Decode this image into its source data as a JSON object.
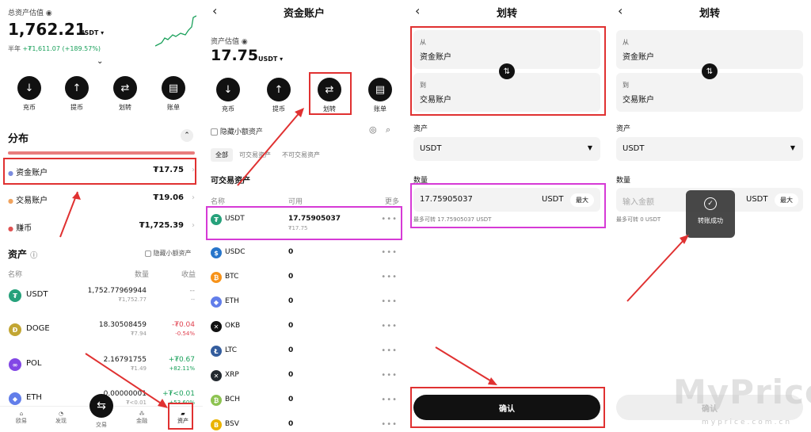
{
  "p1": {
    "total_label": "总资产估值",
    "total_value": "1,762.21",
    "total_unit": "USDT ▾",
    "period": "半年",
    "change": "+₮1,611.07 (+189.57%)",
    "actions": [
      "充币",
      "提币",
      "划转",
      "账单"
    ],
    "dist_title": "分布",
    "accounts": [
      {
        "name": "资金账户",
        "value": "₮17.75",
        "color": "#7b8cde"
      },
      {
        "name": "交易账户",
        "value": "₮19.06",
        "color": "#f0a35e"
      },
      {
        "name": "赚币",
        "value": "₮1,725.39",
        "color": "#e05252"
      }
    ],
    "assets_title": "资产",
    "hide_small": "隐藏小额资产",
    "cols": [
      "名称",
      "数量",
      "收益"
    ],
    "assets": [
      {
        "sym": "USDT",
        "qty": "1,752.77969944",
        "sub": "₮1,752.77",
        "pnl": "--",
        "pnl_pct": "--",
        "color": "#26a17b",
        "glyph": "₮",
        "tone": "neutral"
      },
      {
        "sym": "DOGE",
        "qty": "18.30508459",
        "sub": "₮7.94",
        "pnl": "-₮0.04",
        "pnl_pct": "-0.54%",
        "color": "#c2a633",
        "glyph": "Ð",
        "tone": "neg"
      },
      {
        "sym": "POL",
        "qty": "2.16791755",
        "sub": "₮1.49",
        "pnl": "+₮0.67",
        "pnl_pct": "+82.11%",
        "color": "#8247e5",
        "glyph": "∞",
        "tone": "pos"
      },
      {
        "sym": "ETH",
        "qty": "0.00000001",
        "sub": "₮<0.01",
        "pnl": "+₮<0.01",
        "pnl_pct": "+53.60%",
        "color": "#627eea",
        "glyph": "◆",
        "tone": "pos"
      }
    ],
    "tabbar": [
      "欧易",
      "发现",
      "交易",
      "金融",
      "资产"
    ]
  },
  "p2": {
    "title": "资金账户",
    "est_label": "资产估值",
    "est_value": "17.75",
    "est_unit": "USDT ▾",
    "actions": [
      "充币",
      "提币",
      "划转",
      "账单"
    ],
    "hide_small": "隐藏小额资产",
    "filters": [
      "全部",
      "可交易资产",
      "不可交易资产"
    ],
    "section": "可交易资产",
    "cols": [
      "名称",
      "可用",
      "更多"
    ],
    "coins": [
      {
        "sym": "USDT",
        "val": "17.75905037",
        "sub": "₮17.75",
        "color": "#26a17b",
        "glyph": "₮"
      },
      {
        "sym": "USDC",
        "val": "0",
        "color": "#2775ca",
        "glyph": "$"
      },
      {
        "sym": "BTC",
        "val": "0",
        "color": "#f7931a",
        "glyph": "₿"
      },
      {
        "sym": "ETH",
        "val": "0",
        "color": "#627eea",
        "glyph": "◆"
      },
      {
        "sym": "OKB",
        "val": "0",
        "color": "#111111",
        "glyph": "✕"
      },
      {
        "sym": "LTC",
        "val": "0",
        "color": "#345d9d",
        "glyph": "Ł"
      },
      {
        "sym": "XRP",
        "val": "0",
        "color": "#23292f",
        "glyph": "✕"
      },
      {
        "sym": "BCH",
        "val": "0",
        "color": "#8dc351",
        "glyph": "₿"
      },
      {
        "sym": "BSV",
        "val": "0",
        "color": "#eab300",
        "glyph": "B"
      }
    ]
  },
  "p3": {
    "title": "划转",
    "from_label": "从",
    "from_value": "资金账户",
    "to_label": "到",
    "to_value": "交易账户",
    "asset_label": "资产",
    "asset_value": "USDT",
    "qty_label": "数量",
    "qty_value": "17.75905037",
    "qty_unit": "USDT",
    "max": "最大",
    "avail": "最多可转 17.75905037 USDT",
    "confirm": "确认"
  },
  "p4": {
    "title": "划转",
    "from_label": "从",
    "from_value": "资金账户",
    "to_label": "到",
    "to_value": "交易账户",
    "asset_label": "资产",
    "asset_value": "USDT",
    "qty_label": "数量",
    "qty_placeholder": "输入金额",
    "qty_unit": "USDT",
    "max": "最大",
    "avail": "最多可转 0 USDT",
    "toast": "转账成功",
    "confirm": "确认",
    "watermark": "MyPrice",
    "watermark_url": "myprice.com.cn"
  },
  "colors": {
    "highlight_red": "#e03131",
    "highlight_magenta": "#d63ad6",
    "positive": "#19a05a",
    "negative": "#e0414f"
  }
}
